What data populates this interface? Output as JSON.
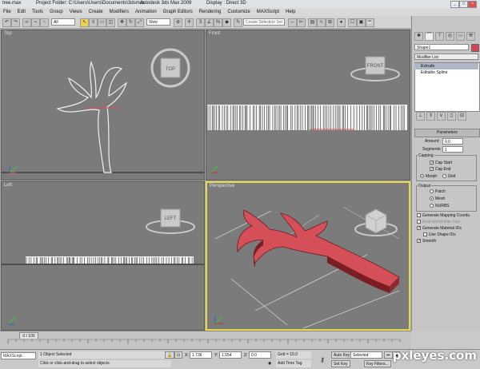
{
  "titlebar": {
    "file": "tree.max",
    "project": "Project Folder: C:\\Users\\Users\\Documents\\3dsmax",
    "app": "Autodesk 3ds Max  2009",
    "display": "Display : Direct 3D",
    "min": "_",
    "max": "□",
    "close": "×"
  },
  "menu": [
    "File",
    "Edit",
    "Tools",
    "Group",
    "Views",
    "Create",
    "Modifiers",
    "Animation",
    "Graph Editors",
    "Rendering",
    "Customize",
    "MAXScript",
    "Help"
  ],
  "toolbar": {
    "filter": "All",
    "view": "View",
    "selection_set": "Create Selection Set"
  },
  "viewports": {
    "top": "Top",
    "front": "Front",
    "left": "Left",
    "perspective": "Perspective",
    "cube_top": "TOP",
    "cube_front": "FRONT",
    "cube_left": "LEFT"
  },
  "panel": {
    "object_name": "Shape1",
    "modifier_list": "Modifier List",
    "stack": [
      "Extrude",
      "Editable Spline"
    ],
    "rollout": "Parameters",
    "amount_label": "Amount:",
    "amount_value": "0.0",
    "segments_label": "Segments:",
    "segments_value": "1",
    "capping_label": "Capping",
    "cap_start": "Cap Start",
    "cap_end": "Cap End",
    "morph": "Morph",
    "grid": "Grid",
    "output_label": "Output",
    "patch": "Patch",
    "mesh": "Mesh",
    "nurbs": "NURBS",
    "gen_mapping": "Generate Mapping Coords.",
    "real_world": "Real-World Map Size",
    "gen_material": "Generate Material IDs",
    "use_shape": "Use Shape IDs",
    "smooth": "Smooth"
  },
  "timeline": {
    "frame": "0 / 100"
  },
  "status": {
    "maxscript": "MAXScript.",
    "selected": "1 Object Selected",
    "prompt": "Click or click-and-drag to select objects",
    "x_label": "X:",
    "x_value": "1.736",
    "y_label": "Y:",
    "y_value": "1.554",
    "z_label": "Z:",
    "z_value": "0.0",
    "grid": "Grid = 10.0",
    "add_time_tag": "Add Time Tag",
    "auto_key": "Auto Key",
    "set_key": "Set Key",
    "selected_dd": "Selected",
    "key_filters": "Key Filters..."
  },
  "watermark": "pxleyes.com",
  "colors": {
    "viewport_bg": "#7b7b7b",
    "active_border": "#e8d84a",
    "extrude_red": "#d44f57",
    "spline_white": "#f2f2f2"
  }
}
